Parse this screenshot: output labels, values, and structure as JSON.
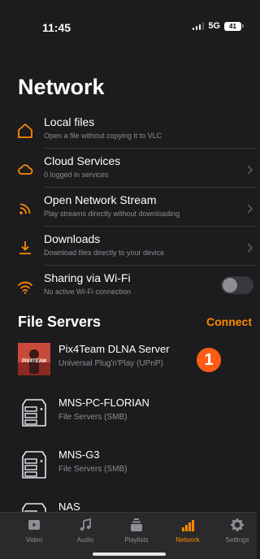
{
  "status_bar": {
    "time": "11:45",
    "network": "5G",
    "battery": "41"
  },
  "page_title": "Network",
  "menu": [
    {
      "title": "Local files",
      "subtitle": "Open a file without copying it to VLC",
      "icon": "house-icon",
      "chevron": false
    },
    {
      "title": "Cloud Services",
      "subtitle": "0 logged in services",
      "icon": "cloud-icon",
      "chevron": true
    },
    {
      "title": "Open Network Stream",
      "subtitle": "Play streams directly without downloading",
      "icon": "rss-feed-icon",
      "chevron": true
    },
    {
      "title": "Downloads",
      "subtitle": "Download files directly to your device",
      "icon": "download-icon",
      "chevron": true
    },
    {
      "title": "Sharing via Wi-Fi",
      "subtitle": "No active Wi-Fi connection",
      "icon": "wifi-icon",
      "toggle": false
    }
  ],
  "file_servers": {
    "title": "File Servers",
    "connect_label": "Connect",
    "items": [
      {
        "name": "Pix4Team DLNA Server",
        "type": "Universal Plug'n'Play (UPnP)",
        "thumb_text": "PIX4TEAM"
      },
      {
        "name": "MNS-PC-FLORIAN",
        "type": "File Servers (SMB)"
      },
      {
        "name": "MNS-G3",
        "type": "File Servers (SMB)"
      },
      {
        "name": "NAS",
        "type": ""
      }
    ]
  },
  "badge": "1",
  "tabs": [
    {
      "label": "Video",
      "icon": "video-icon",
      "active": false
    },
    {
      "label": "Audio",
      "icon": "music-note-icon",
      "active": false
    },
    {
      "label": "Playlists",
      "icon": "playlist-icon",
      "active": false
    },
    {
      "label": "Network",
      "icon": "network-bars-icon",
      "active": true
    },
    {
      "label": "Settings",
      "icon": "gear-icon",
      "active": false
    }
  ],
  "colors": {
    "accent": "#ff8800",
    "badge": "#ff5b14",
    "background": "#1c1c1e",
    "tab_bar": "#2a2a2c"
  }
}
